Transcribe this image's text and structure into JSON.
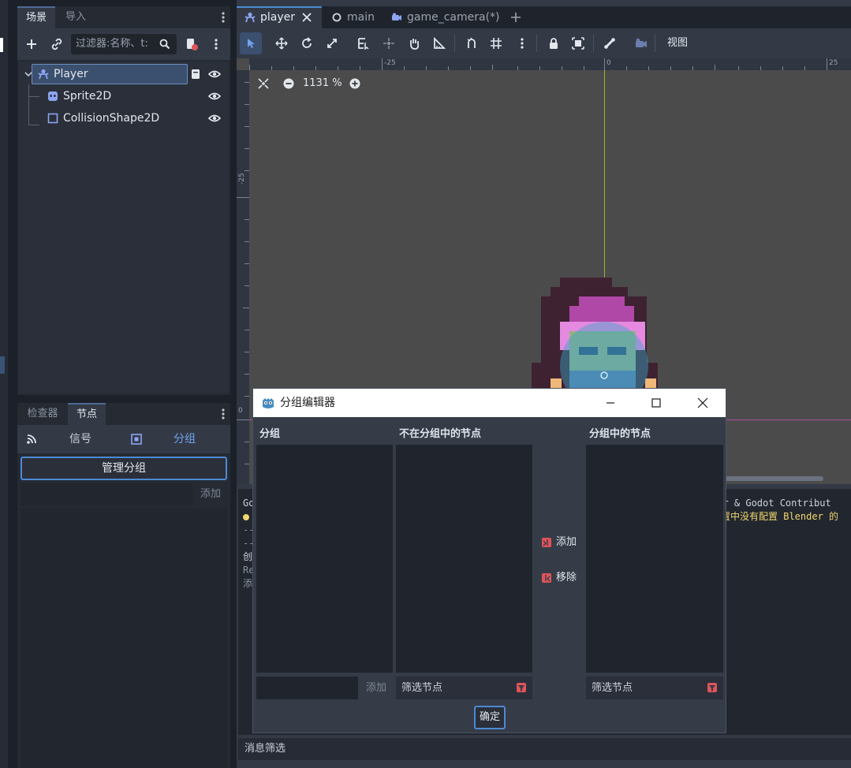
{
  "left_dock": {
    "top_tabs": [
      "场景",
      "导入"
    ],
    "filter_placeholder": "过滤器:名称、t:",
    "tree": [
      {
        "label": "Player",
        "icon": "character-body-icon",
        "selected": true
      },
      {
        "label": "Sprite2D",
        "icon": "sprite-icon"
      },
      {
        "label": "CollisionShape2D",
        "icon": "collision-shape-icon"
      }
    ],
    "bottom_tabs": [
      "检查器",
      "节点"
    ],
    "signals_label": "信号",
    "groups_label": "分组",
    "manage_groups_label": "管理分组",
    "add_label": "添加"
  },
  "editor": {
    "tabs": [
      {
        "label": "player",
        "icon": "character-body-icon",
        "active": true
      },
      {
        "label": "main",
        "icon": "node-circle-icon"
      },
      {
        "label": "game_camera(*)",
        "icon": "camera-icon"
      }
    ],
    "view_menu": "视图",
    "zoom": "1131 %",
    "ruler_labels": {
      "top": [
        "-25",
        "0",
        "25"
      ],
      "left": [
        "-25",
        "0"
      ]
    },
    "output_lines": [
      {
        "left": "Go",
        "right": "zur & Godot Contribut",
        "color": "#cdd3dc"
      },
      {
        "left": "",
        "right": "设置中没有配置 Blender 的",
        "color": "#f0d770"
      },
      {
        "left": "--",
        "right": "",
        "color": "#8a93a1"
      },
      {
        "left": "--",
        "right": "",
        "color": "#8a93a1"
      },
      {
        "left": "创",
        "right": "",
        "color": "#cdd3dc"
      },
      {
        "left": "Re",
        "right": "",
        "color": "#8a93a1"
      },
      {
        "left": "添",
        "right": "",
        "color": "#8a93a1"
      }
    ],
    "message_filter": "消息筛选"
  },
  "dialog": {
    "title": "分组编辑器",
    "groups_header": "分组",
    "not_in_group_header": "不在分组中的节点",
    "in_group_header": "分组中的节点",
    "add_button": "添加",
    "remove_button": "移除",
    "group_add_button": "添加",
    "filter_placeholder": "筛选节点",
    "confirm": "确定"
  },
  "colors": {
    "accent": "#4d8ad3",
    "yellow_text": "#f0d770",
    "icon_red": "#e0535a",
    "icon_blue": "#8da5f3"
  }
}
